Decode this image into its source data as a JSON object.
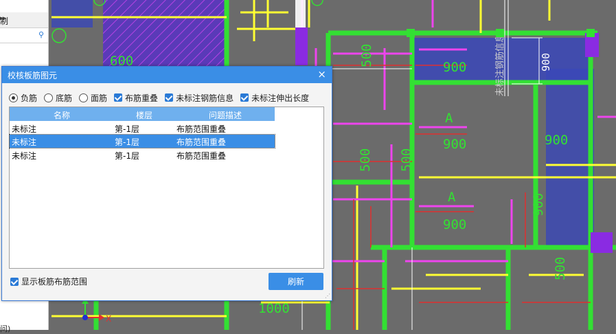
{
  "side_panel": {
    "row_label": "制",
    "bottom_text": "问)"
  },
  "canvas_labels": {
    "dim_600": "600",
    "dim_500": "500",
    "dim_900": "900",
    "dim_1000": "1000",
    "letter_a": "A",
    "vertical_text": "未标注钢筋信息",
    "axis_x": "X"
  },
  "dialog": {
    "title": "校核板筋图元",
    "close": "×",
    "options": {
      "radio_negative": "负筋",
      "radio_bottom": "底筋",
      "radio_top": "面筋",
      "check_overlap": "布筋重叠",
      "check_unlabeled_info": "未标注钢筋信息",
      "check_unlabeled_extend": "未标注伸出长度"
    },
    "table": {
      "headers": [
        "名称",
        "楼层",
        "问题描述"
      ],
      "rows": [
        {
          "name": "未标注",
          "floor": "第-1层",
          "desc": "布筋范围重叠"
        },
        {
          "name": "未标注",
          "floor": "第-1层",
          "desc": "布筋范围重叠"
        },
        {
          "name": "未标注",
          "floor": "第-1层",
          "desc": "布筋范围重叠"
        }
      ]
    },
    "show_range_label": "显示板筋布筋范围",
    "refresh_label": "刷新"
  },
  "colors": {
    "canvas_bg": "#6b6b6b",
    "green": "#33e033",
    "magenta": "#ee44ee",
    "yellow": "#ffff33",
    "blue_region": "#3a47b8",
    "dialog_accent": "#3a8ee6"
  }
}
